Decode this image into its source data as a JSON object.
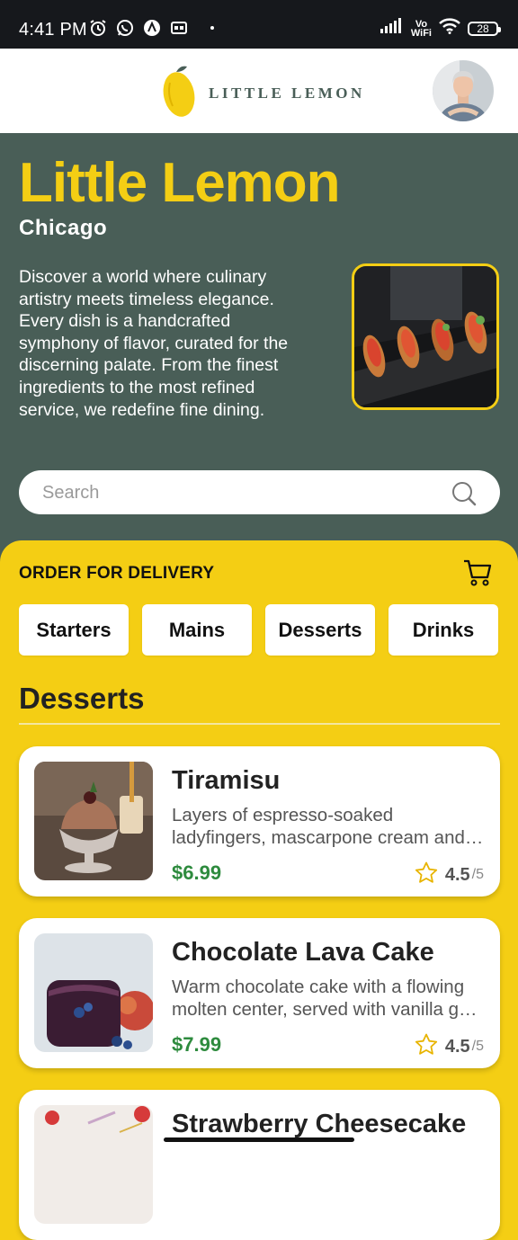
{
  "status_bar": {
    "time": "4:41 PM",
    "vowifi_top": "Vo",
    "vowifi_bottom": "WiFi",
    "battery": "28"
  },
  "header": {
    "logo_text": "LITTLE LEMON",
    "icons": [
      "lemon-logo-icon",
      "profile-avatar"
    ]
  },
  "hero": {
    "title": "Little Lemon",
    "city": "Chicago",
    "description": "Discover a world where culinary artistry meets timeless elegance. Every dish is a handcrafted symphony of flavor, curated for the discerning palate. From the finest ingredients to the most refined service, we redefine fine dining.",
    "search_placeholder": "Search"
  },
  "delivery": {
    "title": "ORDER FOR DELIVERY",
    "categories": [
      "Starters",
      "Mains",
      "Desserts",
      "Drinks"
    ],
    "section_title": "Desserts"
  },
  "menu_items": [
    {
      "name": "Tiramisu",
      "desc_line1": "Layers of espresso-soaked",
      "desc_line2": "ladyfingers, mascarpone cream and…",
      "price": "$6.99",
      "rating": "4.5",
      "rating_max": "/5"
    },
    {
      "name": "Chocolate Lava Cake",
      "desc_line1": "Warm chocolate cake with a flowing",
      "desc_line2": "molten center, served with vanilla g…",
      "price": "$7.99",
      "rating": "4.5",
      "rating_max": "/5"
    },
    {
      "name": "Strawberry Cheesecake"
    }
  ],
  "colors": {
    "primary_green": "#495E57",
    "primary_yellow": "#F4CE14",
    "price_green": "#2e8b3e"
  }
}
